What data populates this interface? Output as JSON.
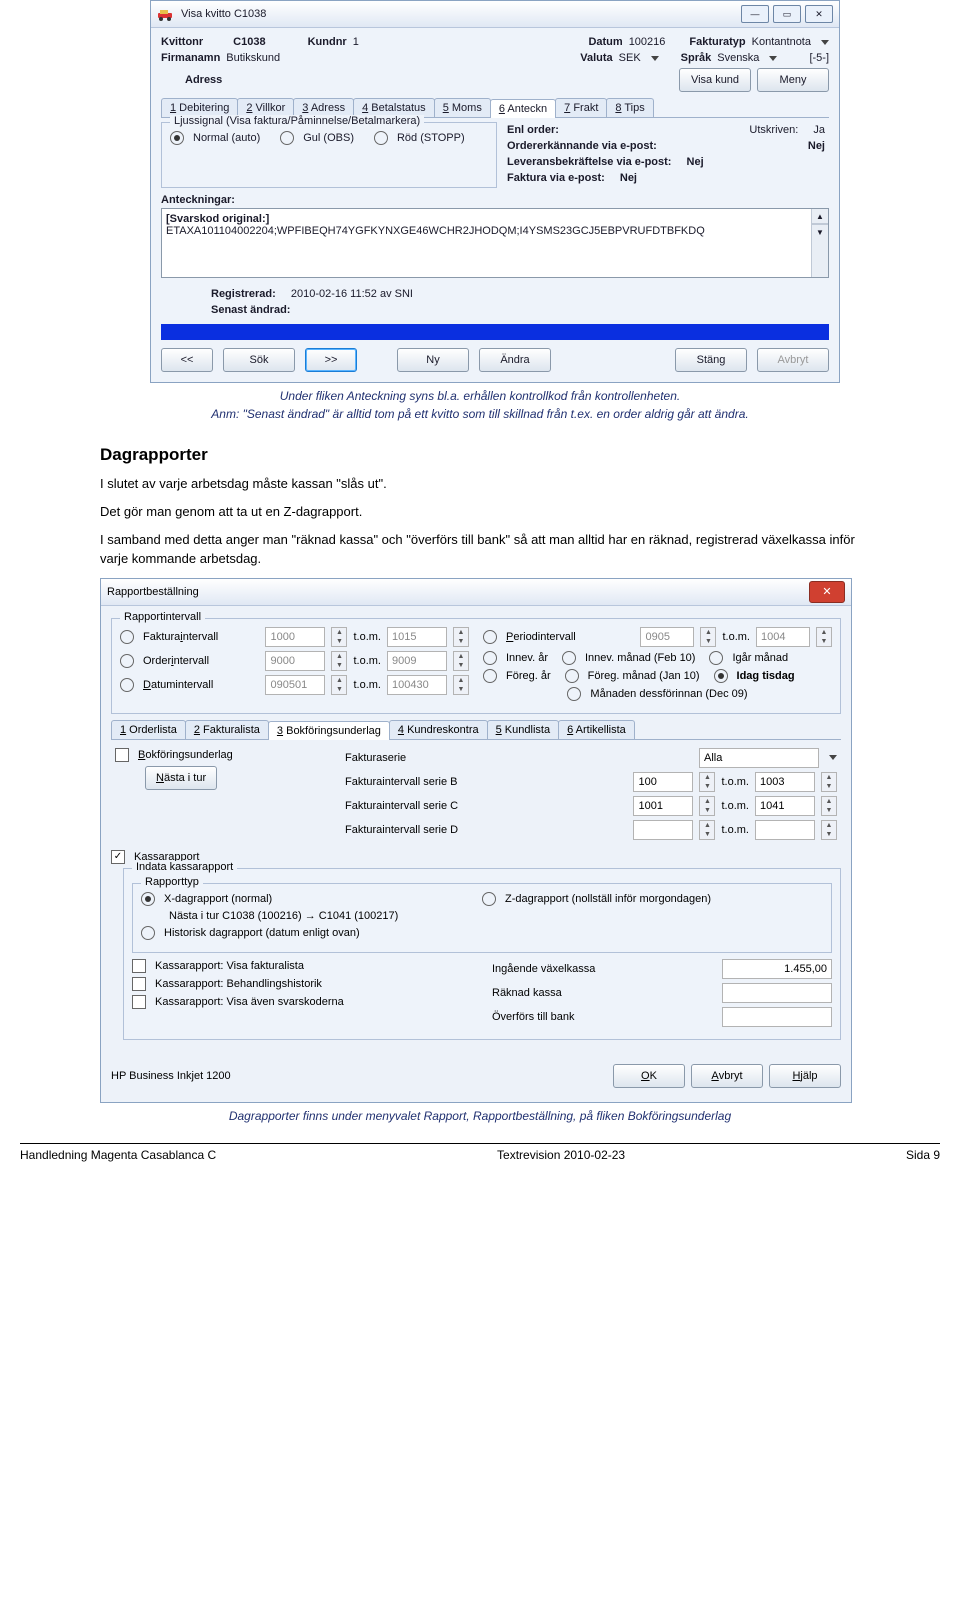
{
  "win1": {
    "title": "Visa kvitto C1038",
    "fields": {
      "kvittonr_l": "Kvittonr",
      "kvittonr": "C1038",
      "kundnr_l": "Kundnr",
      "kundnr": "1",
      "datum_l": "Datum",
      "datum": "100216",
      "fakturatyp_l": "Fakturatyp",
      "fakturatyp": "Kontantnota",
      "firmanamn_l": "Firmanamn",
      "firmanamn": "Butikskund",
      "valuta_l": "Valuta",
      "valuta": "SEK",
      "sprak_l": "Språk",
      "sprak": "Svenska",
      "bracket": "[-5-]",
      "adress_l": "Adress",
      "visakund": "Visa kund",
      "meny": "Meny"
    },
    "tabs": [
      "1 Debitering",
      "2 Villkor",
      "3 Adress",
      "4 Betalstatus",
      "5 Moms",
      "6 Anteckn",
      "7 Frakt",
      "8 Tips"
    ],
    "active_tab": 5,
    "ljus": {
      "title": "Ljussignal (Visa faktura/Påminnelse/Betalmarkera)",
      "opts": [
        "Normal (auto)",
        "Gul (OBS)",
        "Röd (STOPP)"
      ],
      "sel": 0
    },
    "right": {
      "enl": "Enl order:",
      "utskr_l": "Utskriven:",
      "utskr": "Ja",
      "oe": "Ordererkännande via e-post:",
      "oe_v": "Nej",
      "lb": "Leveransbekräftelse via e-post:",
      "lb_v": "Nej",
      "fk": "Faktura via e-post:",
      "fk_v": "Nej"
    },
    "ant_l": "Anteckningar:",
    "ta_l1": "[Svarskod original:]",
    "ta_l2": "ETAXA101104002204;WPFIBEQH74YGFKYNXGE46WCHR2JHODQM;I4YSMS23GCJ5EBPVRUFDTBFKDQ",
    "reg_l": "Registrerad:",
    "reg": "2010-02-16 11:52 av SNI",
    "sen_l": "Senast ändrad:",
    "nav": {
      "first": "<<",
      "sok": "Sök",
      "next": ">>",
      "ny": "Ny",
      "andra": "Ändra",
      "stang": "Stäng",
      "avbryt": "Avbryt"
    }
  },
  "caption1": "Under fliken Anteckning syns bl.a. erhållen kontrollkod från kontrollenheten.",
  "caption1b": "Anm: \"Senast ändrad\" är alltid tom på ett kvitto som till skillnad från t.ex. en order aldrig går att ändra.",
  "h2": "Dagrapporter",
  "p1": "I slutet av varje arbetsdag måste kassan \"slås ut\".",
  "p2": "Det gör man genom att ta ut en Z-dagrapport.",
  "p3": "I samband med detta anger man \"räknad kassa\" och \"överförs till bank\" så att man alltid har en räknad, registrerad växelkassa inför varje kommande arbetsdag.",
  "win2": {
    "title": "Rapportbeställning",
    "grp1": "Rapportintervall",
    "rows": {
      "fi": {
        "l": "Fakturaintervall",
        "a": "1000",
        "b": "1015"
      },
      "oi": {
        "l": "Orderintervall",
        "a": "9000",
        "b": "9009"
      },
      "di": {
        "l": "Datumintervall",
        "a": "090501",
        "b": "100430"
      },
      "tom": "t.o.m.",
      "pi": {
        "l": "Periodintervall",
        "a": "0905",
        "b": "1004"
      },
      "iar": "Innev. år",
      "im": "Innev. månad (Feb 10)",
      "igm": "Igår månad",
      "far": "Föreg. år",
      "fm": "Föreg. månad (Jan 10)",
      "idag": "Idag tisdag",
      "mdf": "Månaden dessförinnan (Dec 09)"
    },
    "tabs2": [
      "1 Orderlista",
      "2 Fakturalista",
      "3 Bokföringsunderlag",
      "4 Kundreskontra",
      "5 Kundlista",
      "6 Artikellista"
    ],
    "active_tab2": 2,
    "bok": {
      "chk": "Bokföringsunderlag",
      "nasta": "Nästa i tur"
    },
    "fs": {
      "serie_l": "Fakturaserie",
      "serie": "Alla",
      "b_l": "Fakturaintervall serie B",
      "b1": "100",
      "b2": "1003",
      "c_l": "Fakturaintervall serie C",
      "c1": "1001",
      "c2": "1041",
      "d_l": "Fakturaintervall serie D"
    },
    "kr": {
      "chk": "Kassarapport",
      "ind": "Indata kassarapport",
      "rt": "Rapporttyp",
      "x": "X-dagrapport (normal)",
      "xn": "Nästa i tur  C1038 (100216) → C1041 (100217)",
      "z": "Z-dagrapport (nollställ inför morgondagen)",
      "h": "Historisk dagrapport (datum enligt ovan)",
      "k1": "Kassarapport: Visa fakturalista",
      "k2": "Kassarapport: Behandlingshistorik",
      "k3": "Kassarapport: Visa även svarskoderna",
      "ivl": "Ingående växelkassa",
      "iv": "1.455,00",
      "rkl": "Räknad kassa",
      "obl": "Överförs till bank"
    },
    "printer": "HP Business Inkjet 1200",
    "ok": "OK",
    "avbryt": "Avbryt",
    "hjalp": "Hjälp"
  },
  "caption2": "Dagrapporter finns under menyvalet Rapport, Rapportbeställning, på fliken Bokföringsunderlag",
  "footer": {
    "l": "Handledning Magenta Casablanca C",
    "c": "Textrevision 2010-02-23",
    "r": "Sida 9"
  }
}
